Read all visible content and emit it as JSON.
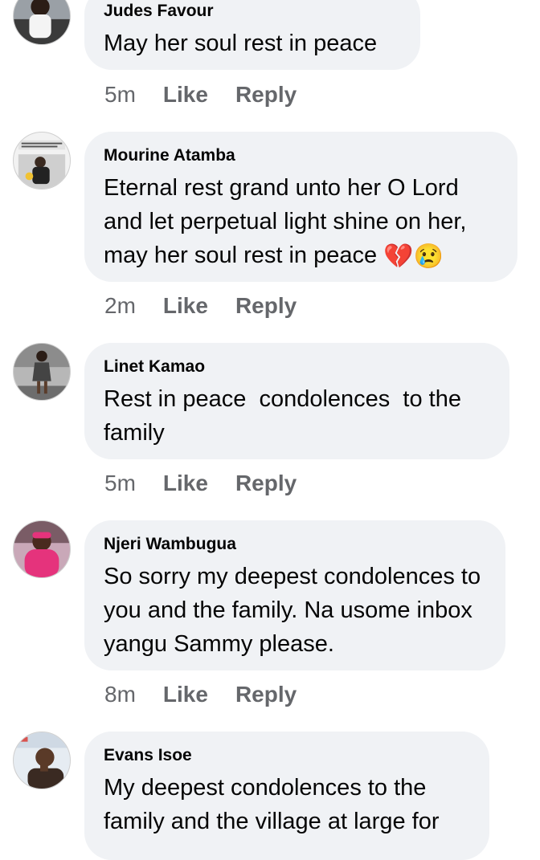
{
  "comments": [
    {
      "author": "Judes Favour",
      "text": "May her soul rest in peace",
      "time": "5m",
      "like_label": "Like",
      "reply_label": "Reply"
    },
    {
      "author": "Mourine Atamba",
      "text": "Eternal rest grand unto her O Lord and let perpetual light shine on her, may her soul rest in peace",
      "emojis": [
        "💔",
        "😢"
      ],
      "time": "2m",
      "like_label": "Like",
      "reply_label": "Reply"
    },
    {
      "author": "Linet Kamao",
      "text": "Rest in peace  condolences  to the family",
      "time": "5m",
      "like_label": "Like",
      "reply_label": "Reply"
    },
    {
      "author": "Njeri Wambugua",
      "text": "So sorry my deepest condolences to you and the family. Na usome inbox yangu Sammy please.",
      "time": "8m",
      "like_label": "Like",
      "reply_label": "Reply"
    },
    {
      "author": "Evans Isoe",
      "text": "My deepest condolences to the family and the village at large for"
    }
  ]
}
